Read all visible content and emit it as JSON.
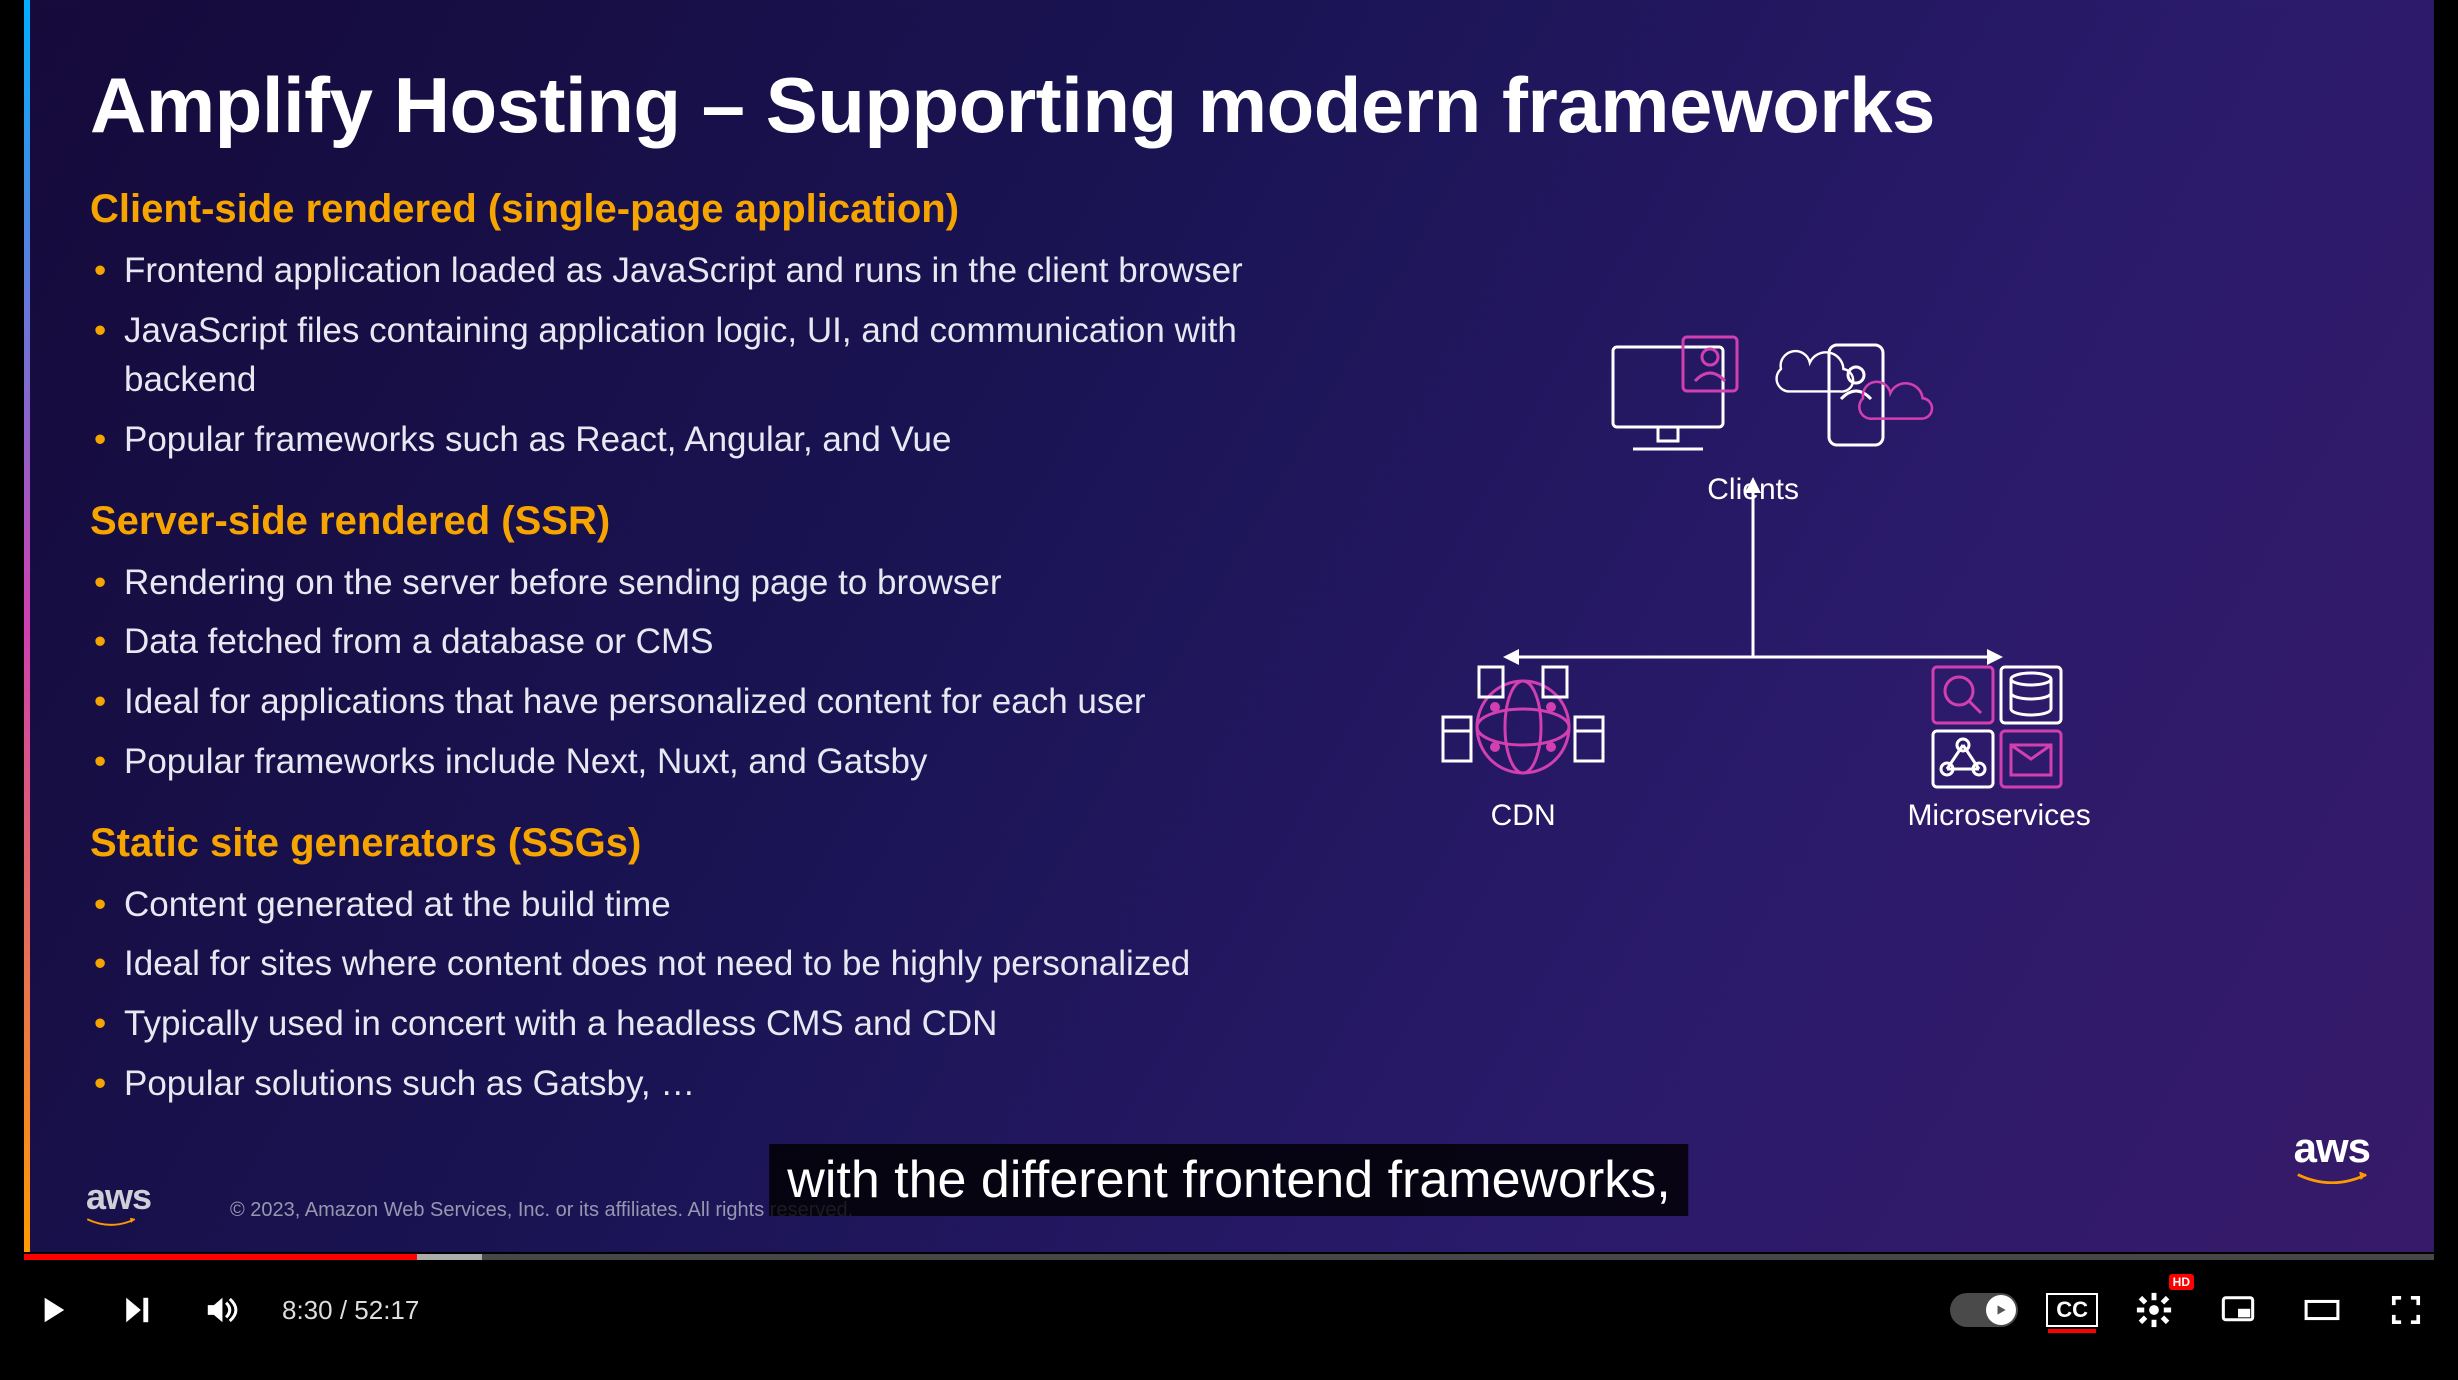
{
  "slide": {
    "title": "Amplify Hosting – Supporting modern frameworks",
    "sections": [
      {
        "heading": "Client-side rendered (single-page application)",
        "items": [
          "Frontend application loaded as JavaScript and runs in the client browser",
          "JavaScript files containing application logic, UI, and communication with backend",
          "Popular frameworks such as React, Angular, and Vue"
        ]
      },
      {
        "heading": "Server-side rendered (SSR)",
        "items": [
          "Rendering on the server before sending page to browser",
          "Data fetched from a database or CMS",
          "Ideal for applications that have personalized content for each user",
          "Popular frameworks include Next, Nuxt, and Gatsby"
        ]
      },
      {
        "heading": "Static site generators (SSGs)",
        "items": [
          "Content generated at the build time",
          "Ideal for sites where content does not need to be highly personalized",
          "Typically used in concert with a headless CMS and CDN",
          "Popular solutions such as Gatsby, …"
        ]
      }
    ],
    "diagram": {
      "clients_label": "Clients",
      "cdn_label": "CDN",
      "microservices_label": "Microservices"
    },
    "footer": {
      "logo_text": "aws",
      "copyright": "© 2023, Amazon Web Services, Inc. or its affiliates. All rights reserved."
    },
    "right_logo": "aws"
  },
  "caption": "with the different frontend frameworks,",
  "player": {
    "current_time": "8:30",
    "duration": "52:17",
    "time_separator": " / ",
    "cc_label": "CC",
    "hd_label": "HD"
  }
}
